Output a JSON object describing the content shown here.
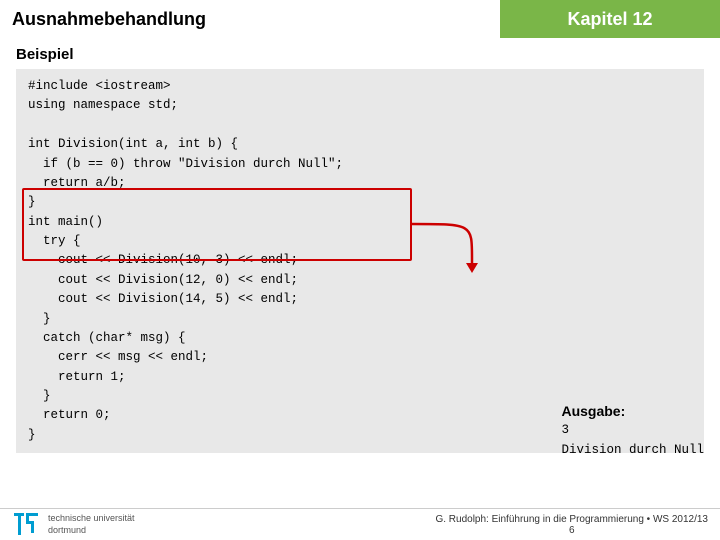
{
  "header": {
    "title": "Ausnahmebehandlung",
    "kapitel": "Kapitel 12"
  },
  "section": {
    "label": "Beispiel"
  },
  "code": {
    "lines": [
      "#include <iostream>",
      "using namespace std;",
      "",
      "int Division(int a, int b) {",
      "  if (b == 0) throw \"Division durch Null\";",
      "  return a/b;",
      "}",
      "int main()",
      "  try {",
      "    cout << Division(10, 3) << endl;",
      "    cout << Division(12, 0) << endl;",
      "    cout << Division(14, 5) << endl;",
      "  }",
      "  catch (char* msg) {",
      "    cerr << msg << endl;",
      "    return 1;",
      "  }",
      "  return 0;",
      "}"
    ]
  },
  "output": {
    "label": "Ausgabe:",
    "value": "3\nDivision durch Null"
  },
  "footer": {
    "uni_line1": "technische universität",
    "uni_line2": "dortmund",
    "citation": "G. Rudolph: Einführung in die Programmierung • WS 2012/13",
    "page": "6"
  }
}
